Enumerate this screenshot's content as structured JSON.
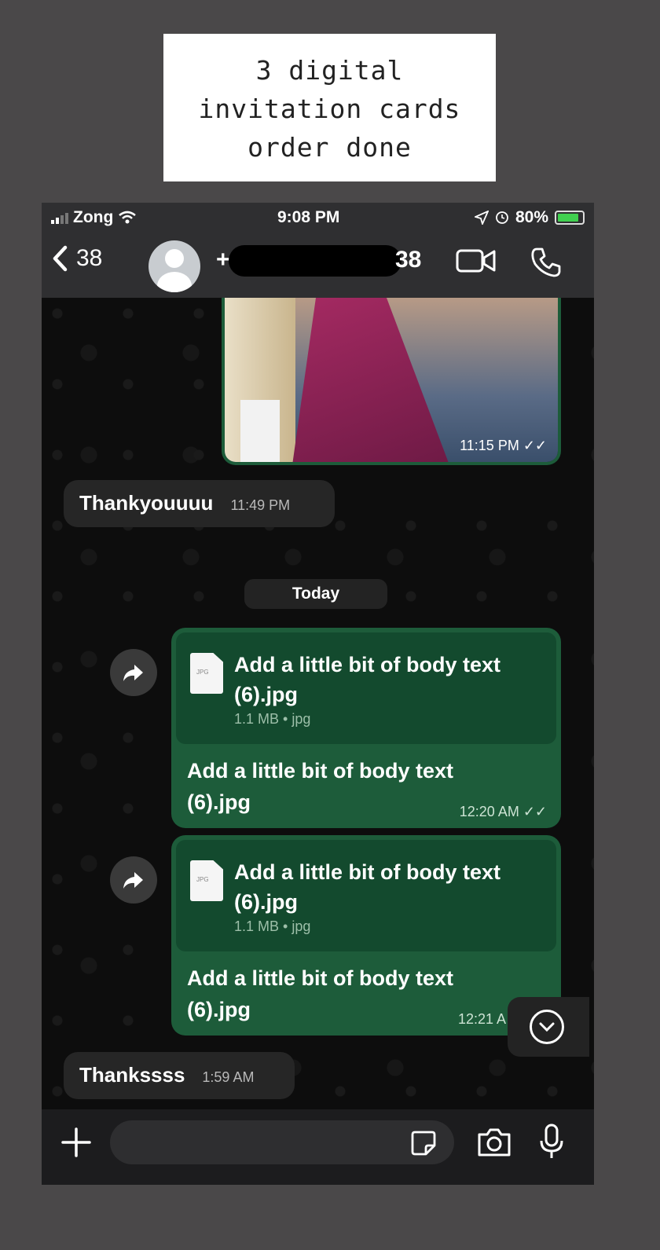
{
  "caption": {
    "line1": "3 digital",
    "line2": "invitation cards",
    "line3": "order done"
  },
  "status_bar": {
    "carrier": "Zong",
    "time": "9:08 PM",
    "battery": "80%"
  },
  "header": {
    "back_count": "38",
    "contact_prefix": "+",
    "contact_suffix": "38",
    "icons": [
      "back-chevron-icon",
      "video-call-icon",
      "voice-call-icon"
    ]
  },
  "messages": {
    "image_time": "11:15 PM",
    "thanks1_text": "Thankyouuuu",
    "thanks1_time": "11:49 PM",
    "date_label": "Today",
    "doc1": {
      "file_name": "Add a little bit of body text (6).jpg",
      "meta": "1.1 MB • jpg",
      "caption": "Add a little bit of body text (6).jpg",
      "time": "12:20 AM",
      "icon_label": "JPG"
    },
    "doc2": {
      "file_name": "Add a little bit of body text (6).jpg",
      "meta": "1.1 MB • jpg",
      "caption": "Add a little bit of body text (6).jpg",
      "time": "12:21 A",
      "icon_label": "JPG"
    },
    "thanks2_text": "Thankssss",
    "thanks2_time": "1:59 AM"
  },
  "input_bar": {
    "icons": [
      "plus-icon",
      "sticker-icon",
      "camera-icon",
      "microphone-icon"
    ]
  },
  "colors": {
    "outgoing_bubble": "#1d5c3a",
    "incoming_bubble": "#262626",
    "header": "#2f2f31"
  }
}
